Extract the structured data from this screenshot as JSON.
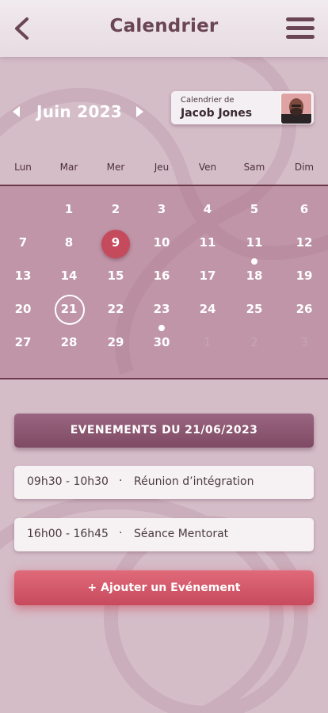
{
  "header": {
    "title": "Calendrier"
  },
  "calendar": {
    "month_label": "Juin 2023",
    "weekdays": [
      "Lun",
      "Mar",
      "Mer",
      "Jeu",
      "Ven",
      "Sam",
      "Dim"
    ],
    "weeks": [
      [
        null,
        "1",
        "2",
        "3",
        "4",
        "5",
        "6"
      ],
      [
        "7",
        "8",
        "9",
        "10",
        "11",
        "11",
        "12"
      ],
      [
        "13",
        "14",
        "15",
        "16",
        "17",
        "18",
        "19"
      ],
      [
        "20",
        "21",
        "22",
        "23",
        "24",
        "25",
        "26"
      ],
      [
        "27",
        "28",
        "29",
        "30",
        "1",
        "2",
        "3"
      ]
    ],
    "today": "9",
    "selected": "21",
    "days_with_events": [
      "18",
      "30"
    ]
  },
  "user_card": {
    "caption": "Calendrier de",
    "name": "Jacob Jones"
  },
  "events": {
    "header": "EVENEMENTS DU 21/06/2023",
    "items": [
      {
        "time": "09h30 - 10h30",
        "title": "Réunion d’intégration"
      },
      {
        "time": "16h00 -  16h45",
        "title": "Séance Mentorat"
      }
    ]
  },
  "add_button": {
    "label": "+ Ajouter un Evénement"
  },
  "colors": {
    "accent": "#c74a5d",
    "brand": "#6a4552",
    "band": "#aa6e86"
  },
  "icons": {
    "back": "chevron-left-icon",
    "menu": "hamburger-menu-icon"
  }
}
